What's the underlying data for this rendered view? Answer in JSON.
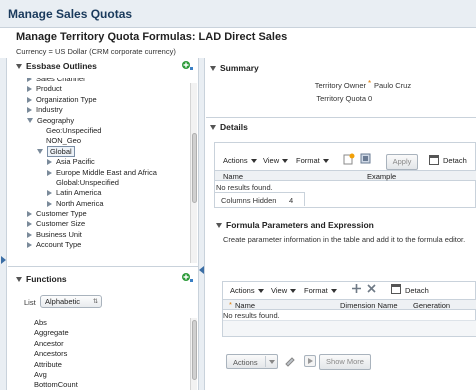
{
  "app": {
    "title": "Manage Sales Quotas"
  },
  "page": {
    "title": "Manage Territory Quota Formulas: LAD Direct Sales",
    "currency": "Currency = US Dollar (CRM corporate currency)"
  },
  "essbase": {
    "header": "Essbase Outlines",
    "tree": [
      {
        "label": "Sales Channel",
        "level": 0,
        "expander": "right"
      },
      {
        "label": "Product",
        "level": 0,
        "expander": "right"
      },
      {
        "label": "Organization Type",
        "level": 0,
        "expander": "right"
      },
      {
        "label": "Industry",
        "level": 0,
        "expander": "right"
      },
      {
        "label": "Geography",
        "level": 0,
        "expander": "down"
      },
      {
        "label": "Geo:Unspecified",
        "level": 1,
        "expander": "none"
      },
      {
        "label": "NON_Geo",
        "level": 1,
        "expander": "none"
      },
      {
        "label": "Global",
        "level": 1,
        "expander": "down",
        "selected": true
      },
      {
        "label": "Asia Pacific",
        "level": 2,
        "expander": "right"
      },
      {
        "label": "Europe Middle East and Africa",
        "level": 2,
        "expander": "right"
      },
      {
        "label": "Global:Unspecified",
        "level": 2,
        "expander": "none"
      },
      {
        "label": "Latin America",
        "level": 2,
        "expander": "right"
      },
      {
        "label": "North America",
        "level": 2,
        "expander": "right"
      },
      {
        "label": "Customer Type",
        "level": 0,
        "expander": "right"
      },
      {
        "label": "Customer Size",
        "level": 0,
        "expander": "right"
      },
      {
        "label": "Business Unit",
        "level": 0,
        "expander": "right"
      },
      {
        "label": "Account Type",
        "level": 0,
        "expander": "right"
      }
    ]
  },
  "functions": {
    "header": "Functions",
    "list_label": "List",
    "list_value": "Alphabetic",
    "items": [
      "Abs",
      "Aggregate",
      "Ancestor",
      "Ancestors",
      "Attribute",
      "Avg",
      "BottomCount"
    ]
  },
  "summary": {
    "header": "Summary",
    "owner_label": "Territory Owner",
    "owner_value": "Paulo Cruz",
    "quota_label": "Territory Quota",
    "quota_value": "0"
  },
  "details": {
    "header": "Details",
    "actions": "Actions",
    "view": "View",
    "format": "Format",
    "apply": "Apply",
    "detach": "Detach",
    "columns": [
      "Name",
      "Example"
    ],
    "empty": "No results found.",
    "columns_hidden_label": "Columns Hidden",
    "columns_hidden_value": "4"
  },
  "formula": {
    "header": "Formula Parameters and Expression",
    "description": "Create parameter information in the table and add it to the formula editor.",
    "actions": "Actions",
    "view": "View",
    "format": "Format",
    "detach": "Detach",
    "columns": [
      "Name",
      "Dimension Name",
      "Generation"
    ],
    "empty": "No results found.",
    "bottom_actions": "Actions",
    "show_more": "Show More"
  },
  "colors": {
    "accent": "#1a3a5c",
    "required": "#e07b00",
    "panel": "#e9eef3"
  }
}
